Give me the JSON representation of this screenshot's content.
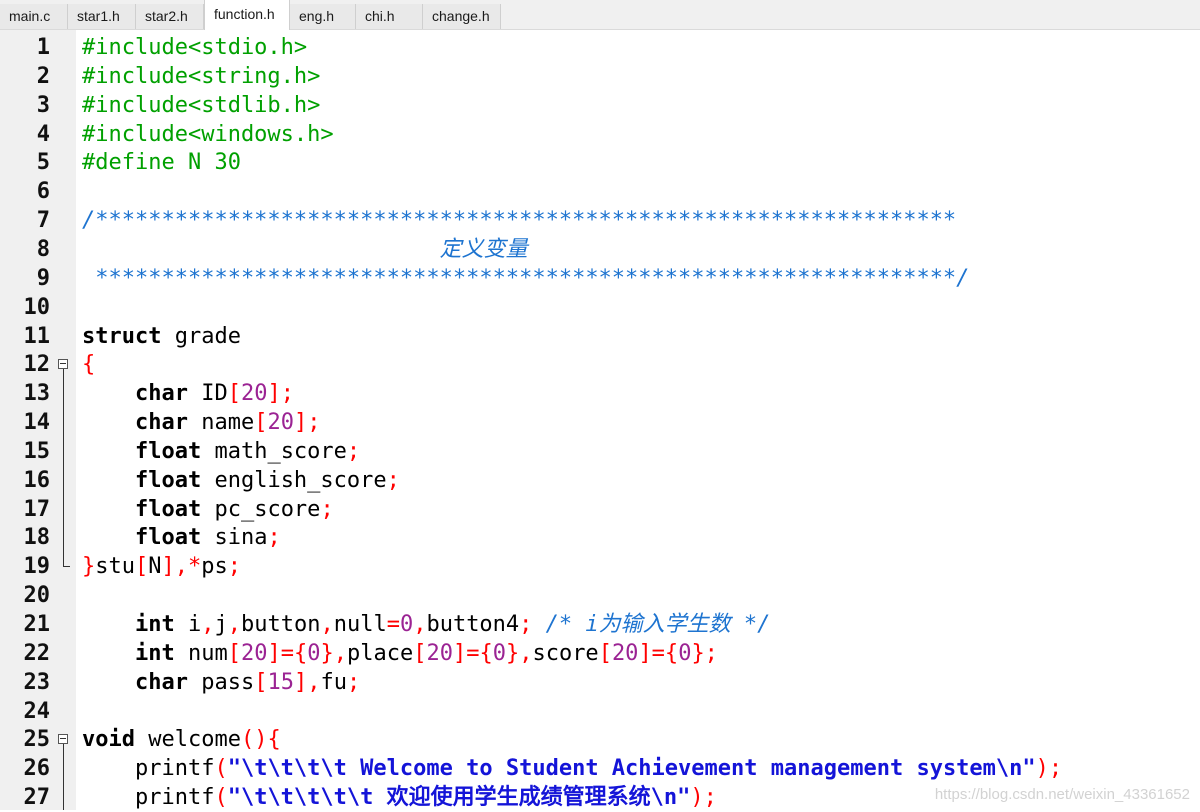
{
  "tabs": [
    {
      "label": "main.c",
      "active": false
    },
    {
      "label": "star1.h",
      "active": false
    },
    {
      "label": "star2.h",
      "active": false
    },
    {
      "label": "function.h",
      "active": true
    },
    {
      "label": "eng.h",
      "active": false
    },
    {
      "label": "chi.h",
      "active": false
    },
    {
      "label": "change.h",
      "active": false
    }
  ],
  "editor": {
    "fold_markers": [
      12,
      25
    ],
    "lines": [
      {
        "n": "1",
        "tokens": [
          {
            "t": "#include<stdio.h>",
            "c": "pp"
          }
        ]
      },
      {
        "n": "2",
        "tokens": [
          {
            "t": "#include<string.h>",
            "c": "pp"
          }
        ]
      },
      {
        "n": "3",
        "tokens": [
          {
            "t": "#include<stdlib.h>",
            "c": "pp"
          }
        ]
      },
      {
        "n": "4",
        "tokens": [
          {
            "t": "#include<windows.h>",
            "c": "pp"
          }
        ]
      },
      {
        "n": "5",
        "tokens": [
          {
            "t": "#define N 30",
            "c": "pp"
          }
        ]
      },
      {
        "n": "6",
        "tokens": []
      },
      {
        "n": "7",
        "tokens": [
          {
            "t": "/*****************************************************************",
            "c": "cm"
          }
        ]
      },
      {
        "n": "8",
        "tokens": [
          {
            "t": "                           定义变量",
            "c": "cm"
          }
        ]
      },
      {
        "n": "9",
        "tokens": [
          {
            "t": " *****************************************************************/",
            "c": "cm"
          }
        ]
      },
      {
        "n": "10",
        "tokens": []
      },
      {
        "n": "11",
        "tokens": [
          {
            "t": "struct",
            "c": "kw"
          },
          {
            "t": " grade",
            "c": ""
          }
        ]
      },
      {
        "n": "12",
        "tokens": [
          {
            "t": "{",
            "c": "red"
          }
        ]
      },
      {
        "n": "13",
        "tokens": [
          {
            "t": "    ",
            "c": ""
          },
          {
            "t": "char",
            "c": "kw"
          },
          {
            "t": " ID",
            "c": ""
          },
          {
            "t": "[",
            "c": "red"
          },
          {
            "t": "20",
            "c": "pur"
          },
          {
            "t": "];",
            "c": "red"
          }
        ]
      },
      {
        "n": "14",
        "tokens": [
          {
            "t": "    ",
            "c": ""
          },
          {
            "t": "char",
            "c": "kw"
          },
          {
            "t": " name",
            "c": ""
          },
          {
            "t": "[",
            "c": "red"
          },
          {
            "t": "20",
            "c": "pur"
          },
          {
            "t": "];",
            "c": "red"
          }
        ]
      },
      {
        "n": "15",
        "tokens": [
          {
            "t": "    ",
            "c": ""
          },
          {
            "t": "float",
            "c": "kw"
          },
          {
            "t": " math_score",
            "c": ""
          },
          {
            "t": ";",
            "c": "red"
          }
        ]
      },
      {
        "n": "16",
        "tokens": [
          {
            "t": "    ",
            "c": ""
          },
          {
            "t": "float",
            "c": "kw"
          },
          {
            "t": " english_score",
            "c": ""
          },
          {
            "t": ";",
            "c": "red"
          }
        ]
      },
      {
        "n": "17",
        "tokens": [
          {
            "t": "    ",
            "c": ""
          },
          {
            "t": "float",
            "c": "kw"
          },
          {
            "t": " pc_score",
            "c": ""
          },
          {
            "t": ";",
            "c": "red"
          }
        ]
      },
      {
        "n": "18",
        "tokens": [
          {
            "t": "    ",
            "c": ""
          },
          {
            "t": "float",
            "c": "kw"
          },
          {
            "t": " sina",
            "c": ""
          },
          {
            "t": ";",
            "c": "red"
          }
        ]
      },
      {
        "n": "19",
        "tokens": [
          {
            "t": "}",
            "c": "red"
          },
          {
            "t": "stu",
            "c": ""
          },
          {
            "t": "[",
            "c": "red"
          },
          {
            "t": "N",
            "c": ""
          },
          {
            "t": "],*",
            "c": "red"
          },
          {
            "t": "ps",
            "c": ""
          },
          {
            "t": ";",
            "c": "red"
          }
        ]
      },
      {
        "n": "20",
        "tokens": []
      },
      {
        "n": "21",
        "tokens": [
          {
            "t": "    ",
            "c": ""
          },
          {
            "t": "int",
            "c": "kw"
          },
          {
            "t": " i",
            "c": ""
          },
          {
            "t": ",",
            "c": "red"
          },
          {
            "t": "j",
            "c": ""
          },
          {
            "t": ",",
            "c": "red"
          },
          {
            "t": "button",
            "c": ""
          },
          {
            "t": ",",
            "c": "red"
          },
          {
            "t": "null",
            "c": ""
          },
          {
            "t": "=",
            "c": "red"
          },
          {
            "t": "0",
            "c": "pur"
          },
          {
            "t": ",",
            "c": "red"
          },
          {
            "t": "button4",
            "c": ""
          },
          {
            "t": ";",
            "c": "red"
          },
          {
            "t": " /* i为输入学生数 */",
            "c": "cm"
          }
        ]
      },
      {
        "n": "22",
        "tokens": [
          {
            "t": "    ",
            "c": ""
          },
          {
            "t": "int",
            "c": "kw"
          },
          {
            "t": " num",
            "c": ""
          },
          {
            "t": "[",
            "c": "red"
          },
          {
            "t": "20",
            "c": "pur"
          },
          {
            "t": "]={",
            "c": "red"
          },
          {
            "t": "0",
            "c": "pur"
          },
          {
            "t": "},",
            "c": "red"
          },
          {
            "t": "place",
            "c": ""
          },
          {
            "t": "[",
            "c": "red"
          },
          {
            "t": "20",
            "c": "pur"
          },
          {
            "t": "]={",
            "c": "red"
          },
          {
            "t": "0",
            "c": "pur"
          },
          {
            "t": "},",
            "c": "red"
          },
          {
            "t": "score",
            "c": ""
          },
          {
            "t": "[",
            "c": "red"
          },
          {
            "t": "20",
            "c": "pur"
          },
          {
            "t": "]={",
            "c": "red"
          },
          {
            "t": "0",
            "c": "pur"
          },
          {
            "t": "};",
            "c": "red"
          }
        ]
      },
      {
        "n": "23",
        "tokens": [
          {
            "t": "    ",
            "c": ""
          },
          {
            "t": "char",
            "c": "kw"
          },
          {
            "t": " pass",
            "c": ""
          },
          {
            "t": "[",
            "c": "red"
          },
          {
            "t": "15",
            "c": "pur"
          },
          {
            "t": "],",
            "c": "red"
          },
          {
            "t": "fu",
            "c": ""
          },
          {
            "t": ";",
            "c": "red"
          }
        ]
      },
      {
        "n": "24",
        "tokens": []
      },
      {
        "n": "25",
        "tokens": [
          {
            "t": "void",
            "c": "kw"
          },
          {
            "t": " welcome",
            "c": ""
          },
          {
            "t": "(){",
            "c": "red"
          }
        ]
      },
      {
        "n": "26",
        "tokens": [
          {
            "t": "    printf",
            "c": ""
          },
          {
            "t": "(",
            "c": "red"
          },
          {
            "t": "\"\\t\\t\\t\\t Welcome to Student Achievement management system\\n\"",
            "c": "str"
          },
          {
            "t": ");",
            "c": "red"
          }
        ]
      },
      {
        "n": "27",
        "tokens": [
          {
            "t": "    printf",
            "c": ""
          },
          {
            "t": "(",
            "c": "red"
          },
          {
            "t": "\"\\t\\t\\t\\t\\t 欢迎使用学生成绩管理系统\\n\"",
            "c": "str"
          },
          {
            "t": ");",
            "c": "red"
          }
        ]
      }
    ]
  },
  "watermark": "https://blog.csdn.net/weixin_43361652"
}
